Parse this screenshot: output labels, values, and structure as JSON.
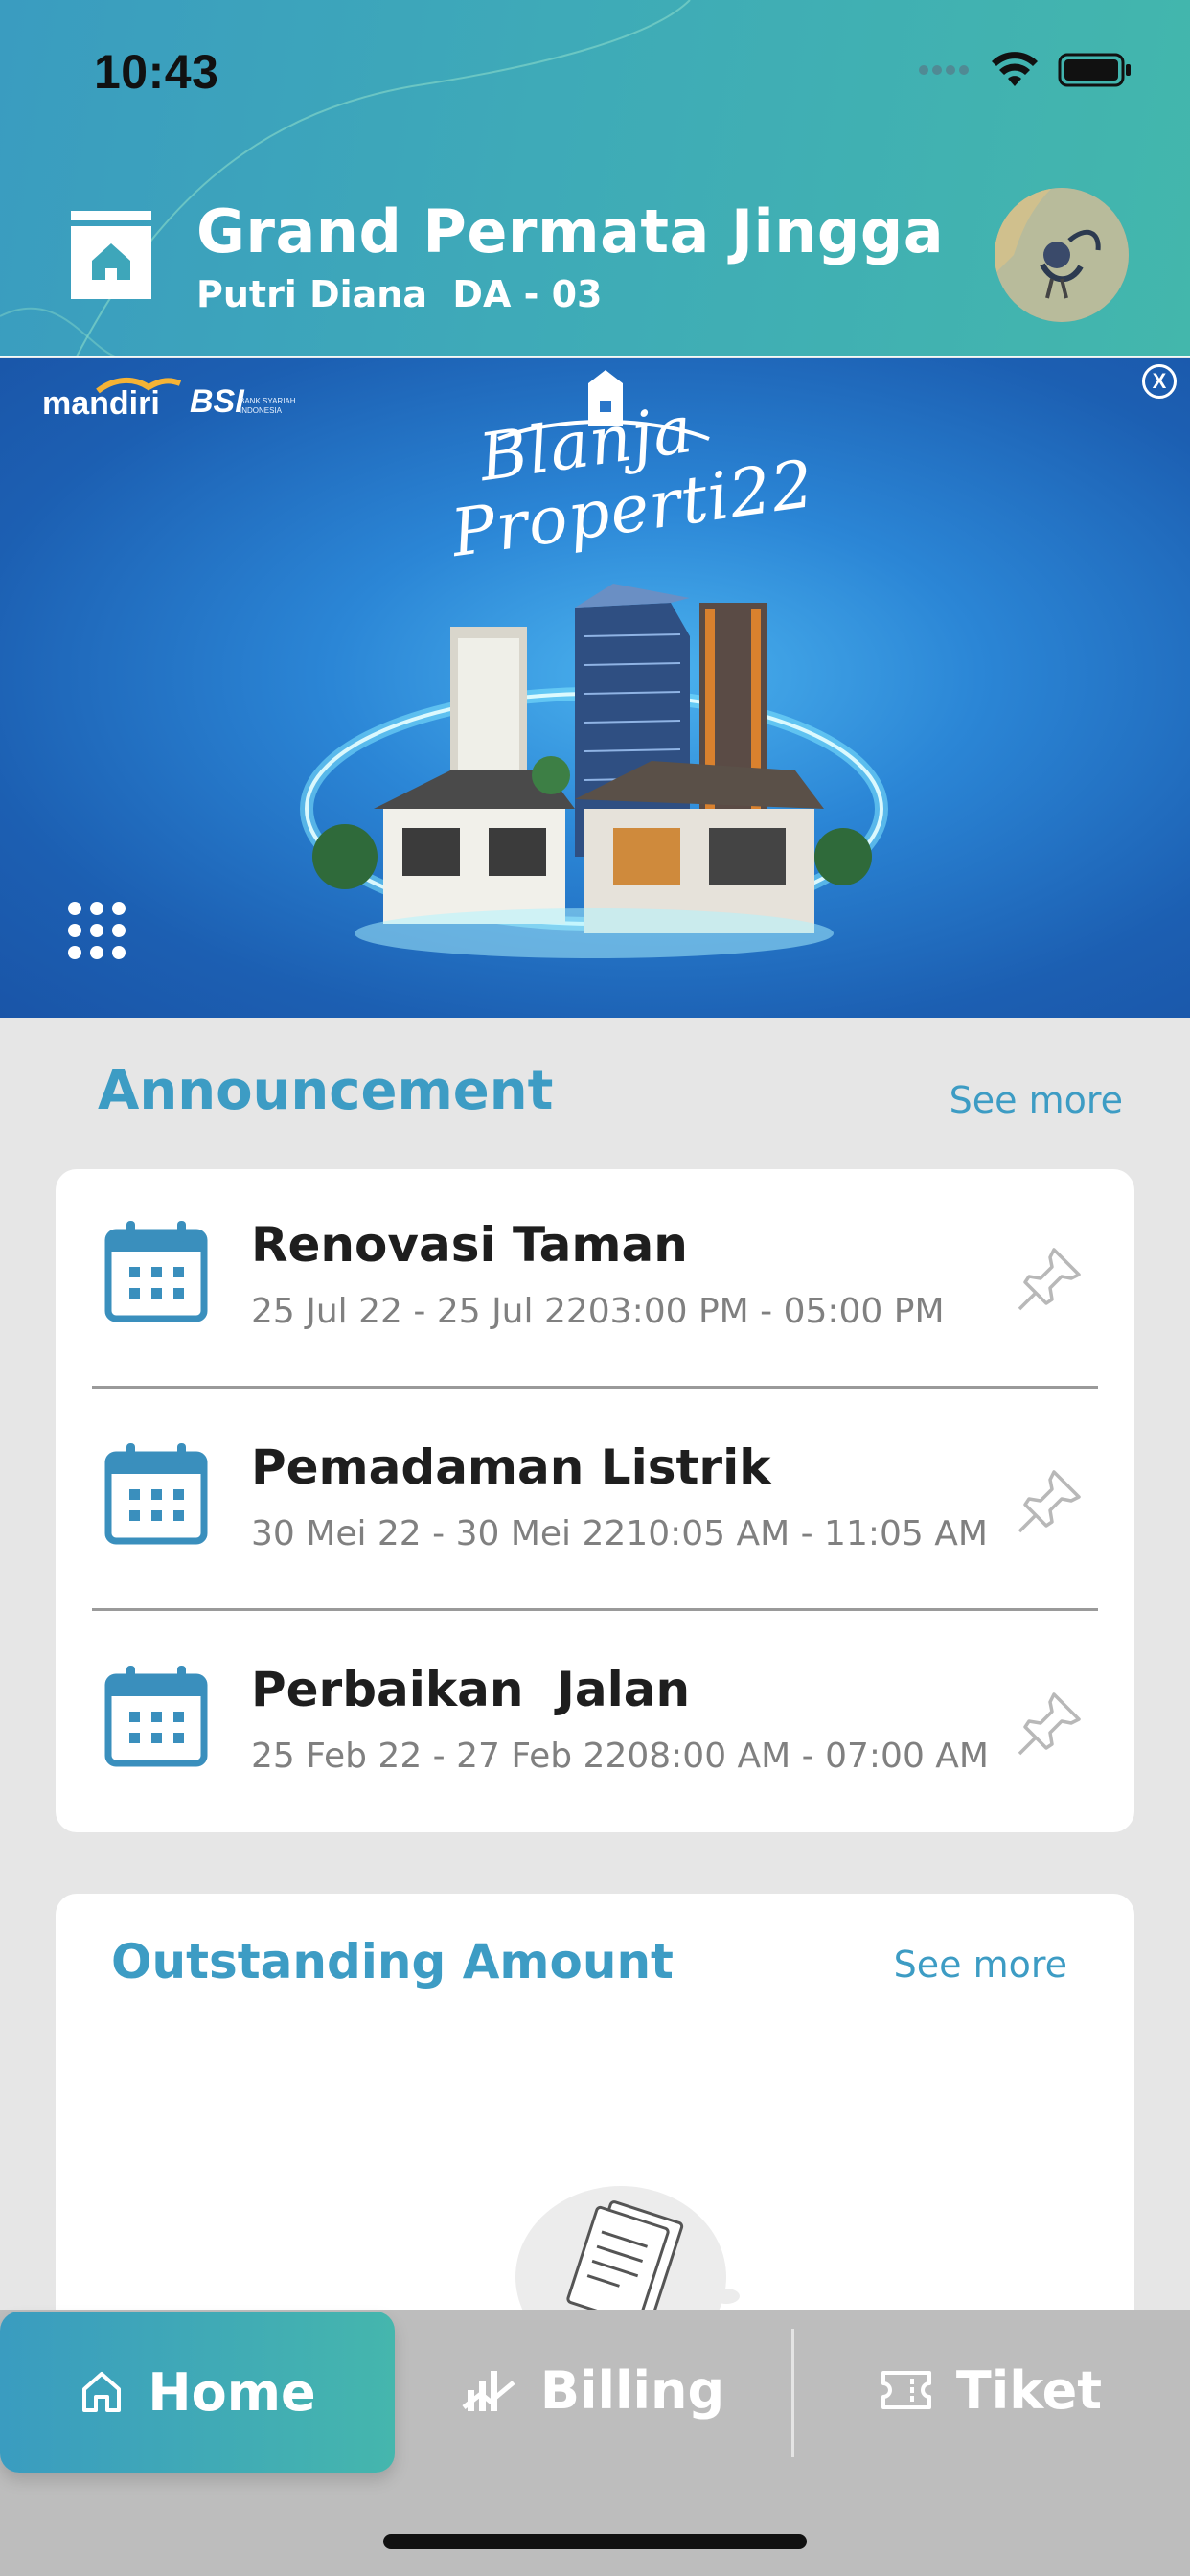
{
  "status_bar": {
    "time": "10:43"
  },
  "header": {
    "title": "Grand Permata Jingga",
    "subtitle": "Putri Diana  DA - 03"
  },
  "banner": {
    "logo_mandiri": "mandiri",
    "logo_bsi": "BSI",
    "logo_bsi_sub": "BANK SYARIAH INDONESIA",
    "promo_line1": "Blanja",
    "promo_line2": "Properti22",
    "close_label": "X"
  },
  "announcement": {
    "title": "Announcement",
    "see_more": "See more",
    "items": [
      {
        "title": "Renovasi Taman",
        "date": "25 Jul 22 - 25 Jul 2203:00 PM - 05:00 PM"
      },
      {
        "title": "Pemadaman Listrik",
        "date": "30 Mei 22 - 30 Mei 2210:05 AM - 11:05 AM"
      },
      {
        "title": "Perbaikan  Jalan",
        "date": "25 Feb 22 - 27 Feb 2208:00 AM - 07:00 AM"
      }
    ]
  },
  "outstanding": {
    "title": "Outstanding Amount",
    "see_more": "See more"
  },
  "tabs": [
    {
      "label": "Home",
      "icon": "home-icon"
    },
    {
      "label": "Billing",
      "icon": "billing-chart-icon"
    },
    {
      "label": "Tiket",
      "icon": "ticket-icon"
    }
  ],
  "colors": {
    "accent": "#3d9cc4",
    "header_start": "#3a9cc0",
    "header_end": "#43b7ac",
    "tabbar": "#bdbdbd"
  }
}
